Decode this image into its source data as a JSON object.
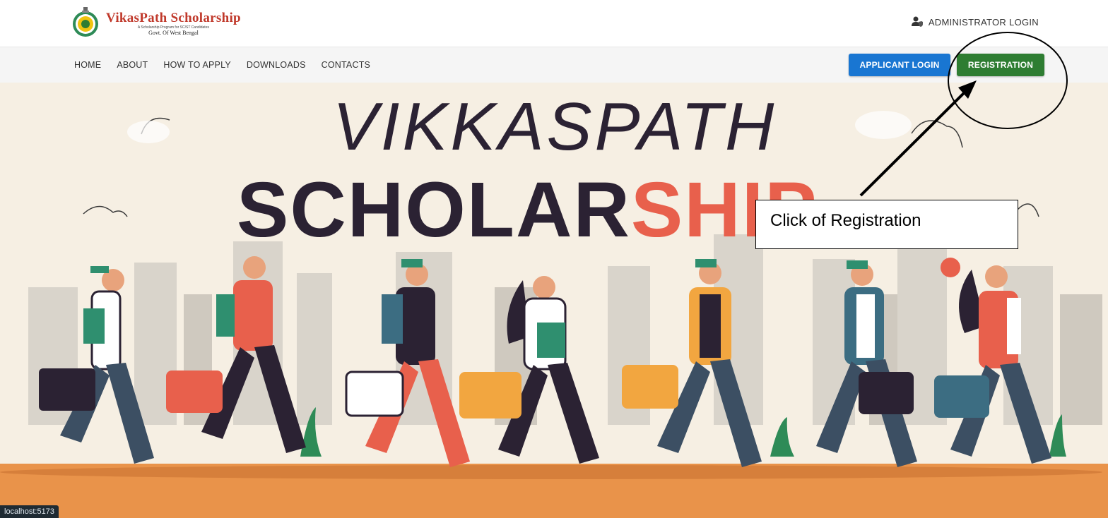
{
  "brand": {
    "name": "VikasPath Scholarship",
    "tagline": "A Scholarship Program for SC/ST Candidates",
    "subtitle": "Govt. Of West Bengal",
    "logo_icon": "state-emblem-icon"
  },
  "header": {
    "admin_label": "ADMINISTRATOR LOGIN",
    "admin_icon": "user-shield-icon"
  },
  "nav": {
    "items": [
      {
        "label": "HOME"
      },
      {
        "label": "ABOUT"
      },
      {
        "label": "HOW TO APPLY"
      },
      {
        "label": "DOWNLOADS"
      },
      {
        "label": "CONTACTS"
      }
    ]
  },
  "buttons": {
    "applicant_login": "APPLICANT LOGIN",
    "registration": "REGISTRATION"
  },
  "hero": {
    "line1": "VIKKASPATH",
    "line2_dark": "SCHOLAR",
    "line2_accent": "SHIP"
  },
  "annotation": {
    "text": "Click of Registration"
  },
  "status_bar": {
    "url": "localhost:5173"
  },
  "colors": {
    "brand_red": "#c0392b",
    "applicant_blue": "#1976d2",
    "register_green": "#2e7d32",
    "hero_dark": "#2b2233",
    "hero_accent": "#e8604c",
    "ground_orange": "#e9934a"
  }
}
